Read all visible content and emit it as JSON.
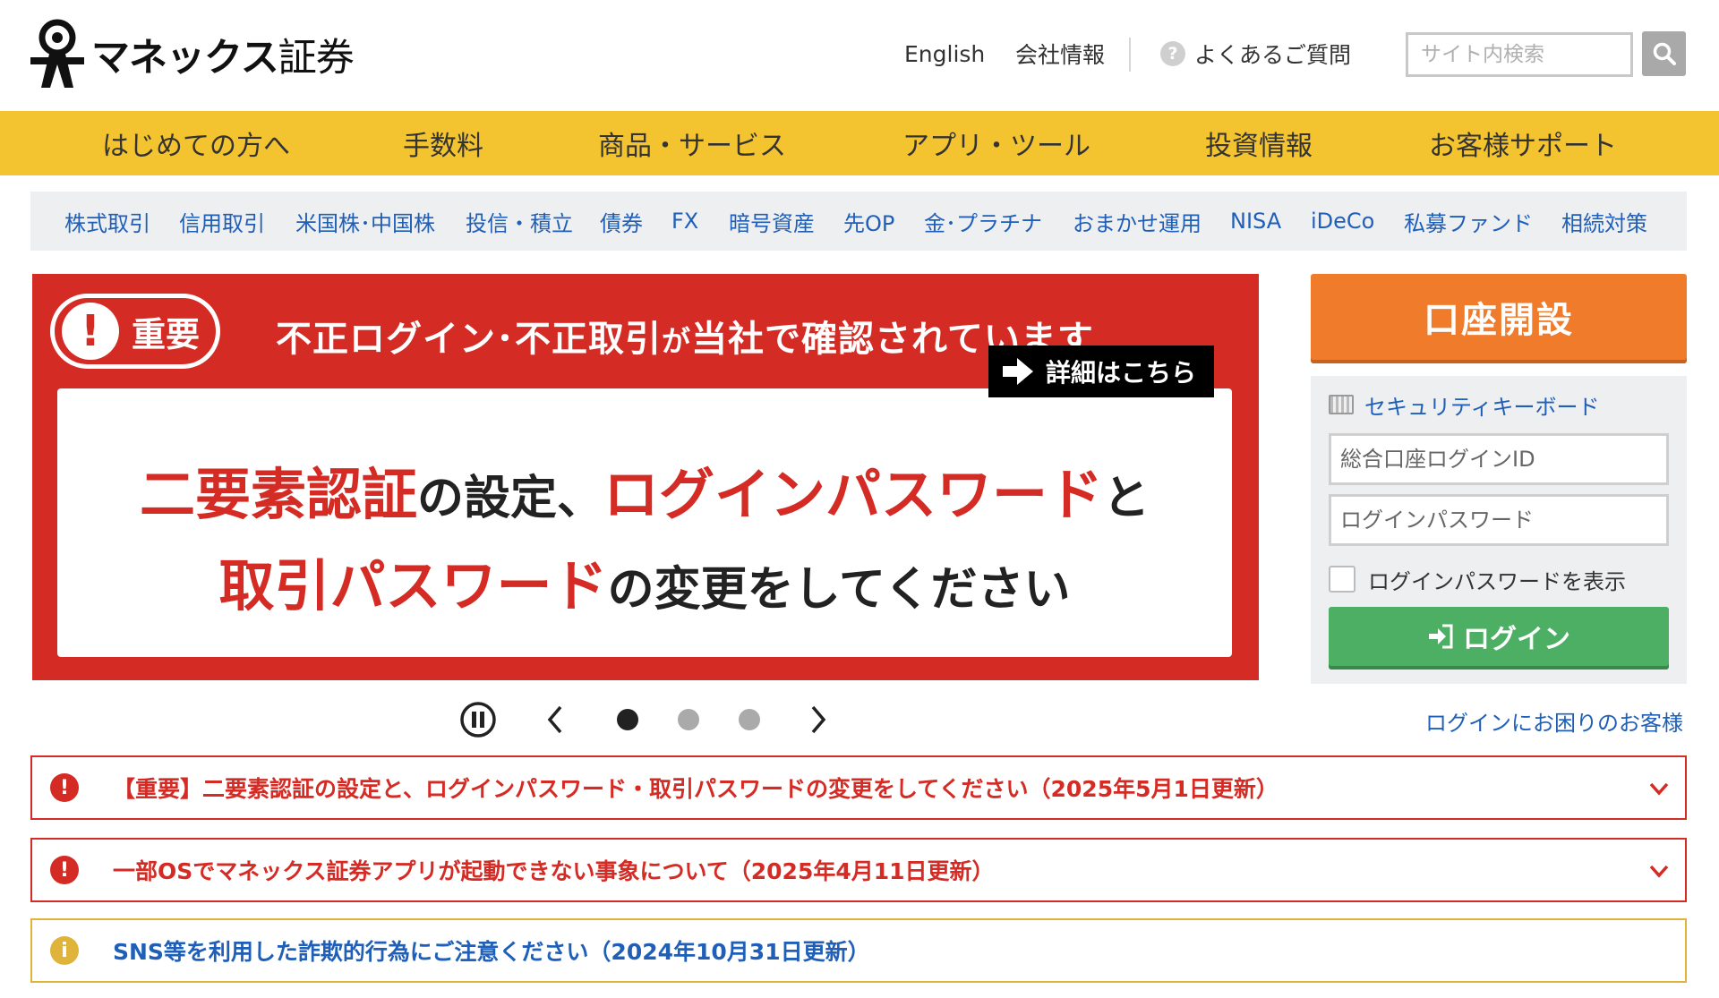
{
  "header": {
    "logo": {
      "brand": "マネックス",
      "suffix": "証券"
    },
    "links": {
      "english": "English",
      "company": "会社情報",
      "faq": "よくあるご質問",
      "faq_icon": "?"
    },
    "search": {
      "placeholder": "サイト内検索",
      "icon": "search-icon"
    }
  },
  "main_nav": [
    "はじめての方へ",
    "手数料",
    "商品・サービス",
    "アプリ・ツール",
    "投資情報",
    "お客様サポート"
  ],
  "sub_nav": [
    "株式取引",
    "信用取引",
    "米国株･中国株",
    "投信・積立",
    "債券",
    "FX",
    "暗号資産",
    "先OP",
    "金･プラチナ",
    "おまかせ運用",
    "NISA",
    "iDeCo",
    "私募ファンド",
    "相続対策"
  ],
  "banner": {
    "badge": "重要",
    "badge_icon": "!",
    "headline_a": "不正ログイン･不正取引",
    "headline_b": "が",
    "headline_c": "当社で確認されています",
    "line1_a": "二要素認証",
    "line1_b": "の設定、",
    "line1_c": "ログインパスワード",
    "line1_d": "と",
    "line2_a": "取引パスワード",
    "line2_b": "の変更をしてください",
    "detail": "詳細はこちら"
  },
  "carousel": {
    "slides": 3,
    "active": 1
  },
  "login": {
    "open_account": "口座開設",
    "security_keyboard": "セキュリティキーボード",
    "id_placeholder": "総合口座ログインID",
    "pw_placeholder": "ログインパスワード",
    "show_password": "ログインパスワードを表示",
    "login_button": "ログイン",
    "trouble": "ログインにお困りのお客様"
  },
  "notices": [
    {
      "level": "important",
      "icon": "!",
      "text": "【重要】二要素認証の設定と、ログインパスワード・取引パスワードの変更をしてください（2025年5月1日更新）"
    },
    {
      "level": "important",
      "icon": "!",
      "text": "一部OSでマネックス証券アプリが起動できない事象について（2025年4月11日更新）"
    },
    {
      "level": "info",
      "icon": "i",
      "text": "SNS等を利用した詐欺的行為にご注意ください（2024年10月31日更新）"
    }
  ],
  "colors": {
    "accent_yellow": "#f4c430",
    "alert_red": "#d52b25",
    "link_blue": "#1f5fb8",
    "open_account_orange": "#f07b2b",
    "login_green": "#4caf63"
  }
}
